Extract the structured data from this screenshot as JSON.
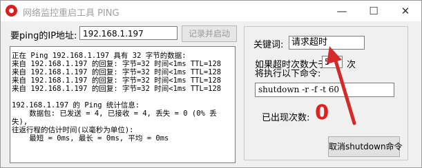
{
  "window": {
    "title": "网络监控重启工具 PING",
    "controls": {
      "minimize": "—",
      "maximize": "☐",
      "close": "✕"
    }
  },
  "ip": {
    "label": "要ping的IP地址:",
    "value": "192.168.1.197",
    "record_button": "记录并启动"
  },
  "log": {
    "lines": [
      "正在 Ping 192.168.1.197 具有 32 字节的数据:",
      "来自 192.168.1.197 的回复: 字节=32 时间<1ms TTL=128",
      "来自 192.168.1.197 的回复: 字节=32 时间<1ms TTL=128",
      "来自 192.168.1.197 的回复: 字节=32 时间<1ms TTL=128",
      "来自 192.168.1.197 的回复: 字节=32 时间<1ms TTL=128",
      "",
      "192.168.1.197 的 Ping 统计信息:",
      "    数据包: 已发送 = 4, 已接收 = 4, 丢失 = 0 (0% 丢",
      "失),",
      "往返行程的估计时间(以毫秒为单位):",
      "    最短 = 0ms, 最长 = 0ms, 平均 = 0ms"
    ]
  },
  "settings": {
    "keyword_label": "关键词:",
    "keyword_value": "请求超时",
    "threshold_label_line1": "如果超时次数大于",
    "threshold_value": "5",
    "threshold_unit": "次",
    "threshold_label_line2": "将执行以下命令:",
    "command_value": "shutdown -r -f -t 60",
    "count_label": "已出现次数:",
    "count_value": "0",
    "cancel_button": "取消shutdown命令"
  },
  "colors": {
    "count_value": "#e0201f",
    "arrow": "#d42a2a",
    "app_icon": "#d8201f"
  }
}
